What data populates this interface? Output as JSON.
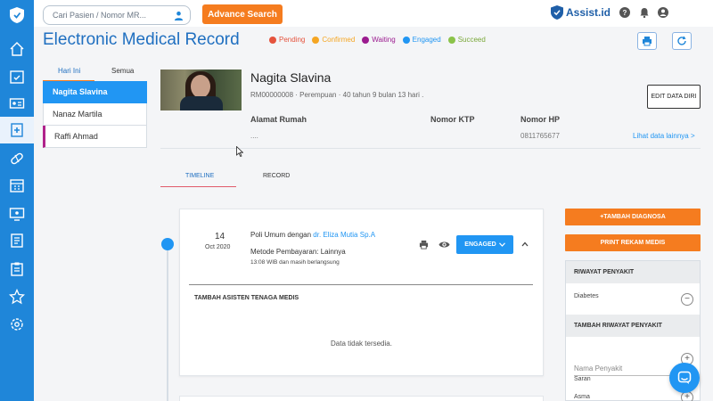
{
  "header": {
    "search_placeholder": "Cari Pasien / Nomor MR...",
    "advance_search_label": "Advance Search",
    "brand_name": "Assist.id"
  },
  "page": {
    "title": "Electronic Medical Record"
  },
  "legend": [
    {
      "label": "Pending",
      "color": "#e5533d"
    },
    {
      "label": "Confirmed",
      "color": "#f5a623"
    },
    {
      "label": "Waiting",
      "color": "#9b1b8f"
    },
    {
      "label": "Engaged",
      "color": "#2196f3"
    },
    {
      "label": "Succeed",
      "color": "#8bc34a"
    }
  ],
  "patient_list": {
    "tabs": [
      "Hari Ini",
      "Semua"
    ],
    "items": [
      "Nagita Slavina",
      "Nanaz Martila",
      "Raffi Ahmad"
    ]
  },
  "patient": {
    "name": "Nagita Slavina",
    "meta": "RM00000008 · Perempuan · 40 tahun 9 bulan 13 hari .",
    "edit_label": "EDIT DATA DIRI",
    "address_label": "Alamat Rumah",
    "address_value": "....",
    "ktp_label": "Nomor KTP",
    "phone_label": "Nomor HP",
    "phone_value": "0811765677",
    "more_link": "Lihat data lainnya >"
  },
  "tabs": [
    "TIMELINE",
    "RECORD"
  ],
  "visit": {
    "day": "14",
    "month_year": "Oct 2020",
    "poli_prefix": "Poli Umum dengan ",
    "doctor": "dr. Eliza Mutia Sp.A",
    "payment": "Metode Pembayaran: Lainnya",
    "time": "13:08 WIB dan masih berlangsung",
    "status": "ENGAGED",
    "assistant_label": "TAMBAH ASISTEN TENAGA MEDIS",
    "empty_text": "Data tidak tersedia."
  },
  "right_panel": {
    "add_diagnosis": "+TAMBAH DIAGNOSA",
    "print_record": "PRINT REKAM MEDIS",
    "history_title": "RIWAYAT PENYAKIT",
    "history_items": [
      "Diabetes"
    ],
    "add_history_title": "TAMBAH RIWAYAT PENYAKIT",
    "disease_placeholder": "Nama Penyakit",
    "suggestions": [
      "Saran",
      "Asma"
    ]
  }
}
